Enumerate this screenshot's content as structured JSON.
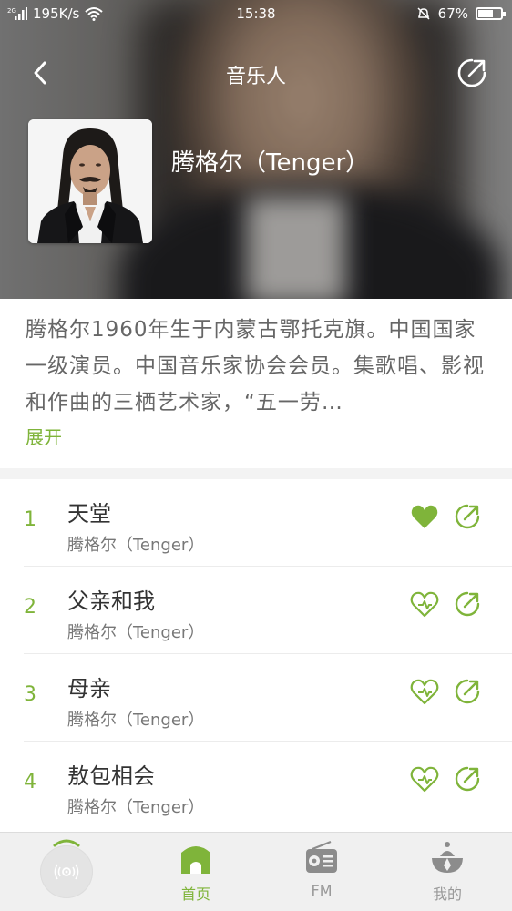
{
  "status_bar": {
    "network_speed": "195K/s",
    "time": "15:38",
    "battery": "67%"
  },
  "header": {
    "title": "音乐人",
    "artist_name": "腾格尔（Tenger）"
  },
  "bio": {
    "text": "腾格尔1960年生于内蒙古鄂托克旗。中国国家一级演员。中国音乐家协会会员。集歌唱、影视和作曲的三栖艺术家，“五一劳…",
    "expand_label": "展开"
  },
  "songs": [
    {
      "index": "1",
      "title": "天堂",
      "artist": "腾格尔（Tenger）",
      "liked": true
    },
    {
      "index": "2",
      "title": "父亲和我",
      "artist": "腾格尔（Tenger）",
      "liked": false
    },
    {
      "index": "3",
      "title": "母亲",
      "artist": "腾格尔（Tenger）",
      "liked": false
    },
    {
      "index": "4",
      "title": "敖包相会",
      "artist": "腾格尔（Tenger）",
      "liked": false
    }
  ],
  "tabs": {
    "home": "首页",
    "fm": "FM",
    "mine": "我的"
  },
  "icons": {
    "back": "back-arrow-icon",
    "share": "share-icon",
    "like": "heart-icon",
    "home": "home-icon",
    "fm": "radio-icon",
    "mine": "profile-icon",
    "player": "disc-icon"
  },
  "colors": {
    "accent": "#7fb43a",
    "text_primary": "#333333",
    "text_secondary": "#777777"
  }
}
